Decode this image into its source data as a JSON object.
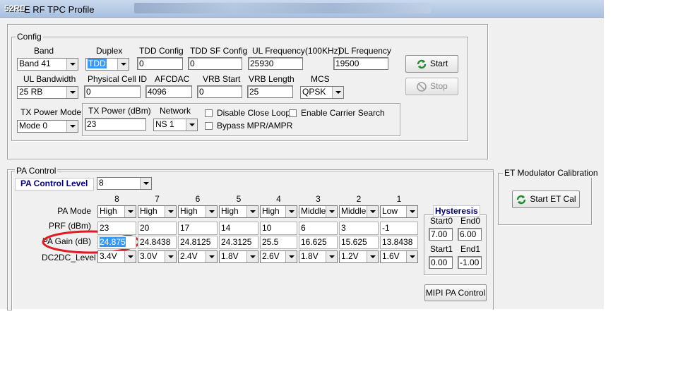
{
  "window": {
    "title": "E RF TPC Profile",
    "badge": "52RD"
  },
  "config": {
    "legend": "Config",
    "labels": {
      "band": "Band",
      "duplex": "Duplex",
      "tdd_config": "TDD Config",
      "tdd_sf_config": "TDD SF Config",
      "ul_frequency": "UL Frequency(100KHz)",
      "dl_frequency": "DL Frequency",
      "ul_bandwidth": "UL Bandwidth",
      "physical_cell_id": "Physical Cell ID",
      "afcdac": "AFCDAC",
      "vrb_start": "VRB Start",
      "vrb_length": "VRB Length",
      "mcs": "MCS",
      "tx_power_mode": "TX Power Mode",
      "tx_power": "TX Power (dBm)",
      "network": "Network"
    },
    "values": {
      "band": "Band 41",
      "duplex": "TDD",
      "tdd_config": "0",
      "tdd_sf_config": "0",
      "ul_frequency": "25930",
      "dl_frequency": "19500",
      "ul_bandwidth": "25 RB",
      "physical_cell_id": "0",
      "afcdac": "4096",
      "vrb_start": "0",
      "vrb_length": "25",
      "mcs": "QPSK",
      "tx_power_mode": "Mode 0",
      "tx_power": "23",
      "network": "NS 1"
    },
    "checkboxes": {
      "disable_close_loop": "Disable Close Loop",
      "enable_carrier_search": "Enable Carrier Search",
      "bypass": "Bypass  MPR/AMPR"
    },
    "buttons": {
      "start": "Start",
      "stop": "Stop"
    }
  },
  "pa_control": {
    "legend": "PA Control",
    "level_label": "PA Control Level",
    "level_value": "8",
    "columns": [
      "8",
      "7",
      "6",
      "5",
      "4",
      "3",
      "2",
      "1"
    ],
    "row_labels": {
      "pa_mode": "PA Mode",
      "prf": "PRF (dBm)",
      "pa_gain": "PA Gain (dB)",
      "dc2dc": "DC2DC_Level"
    },
    "pa_mode": [
      "High",
      "High",
      "High",
      "High",
      "High",
      "Middle",
      "Middle",
      "Low"
    ],
    "prf": [
      "23",
      "20",
      "17",
      "14",
      "10",
      "6",
      "3",
      "-1"
    ],
    "pa_gain": [
      "24.875",
      "24.8438",
      "24.8125",
      "24.3125",
      "25.5",
      "16.625",
      "15.625",
      "13.8438"
    ],
    "dc2dc": [
      "3.4V",
      "3.0V",
      "2.4V",
      "1.8V",
      "2.6V",
      "1.8V",
      "1.2V",
      "1.6V"
    ],
    "hysteresis": {
      "legend": "Hysteresis",
      "start0_label": "Start0",
      "end0_label": "End0",
      "start0": "7.00",
      "end0": "6.00",
      "start1_label": "Start1",
      "end1_label": "End1",
      "start1": "0.00",
      "end1": "-1.00"
    },
    "mipi_button": "MIPI PA Control"
  },
  "et": {
    "legend": "ET Modulator Calibration",
    "button": "Start ET Cal"
  },
  "colors": {
    "highlight": "#3399ff",
    "annotation": "#e01b24",
    "title_accent": "#000080"
  }
}
